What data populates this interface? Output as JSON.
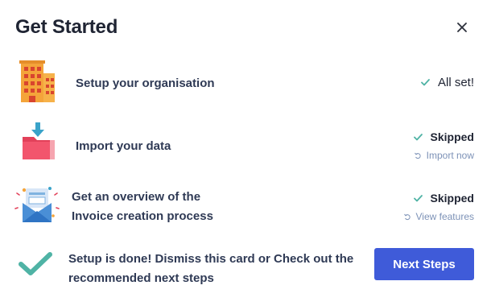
{
  "header": {
    "title": "Get Started",
    "close_icon": "close-icon"
  },
  "steps": [
    {
      "label": "Setup your organisation",
      "status": "All set!",
      "icon": "building-icon"
    },
    {
      "label": "Import your data",
      "status": "Skipped",
      "action": "Import now",
      "icon": "folder-import-icon"
    },
    {
      "label_line1": "Get an overview of the",
      "label_line2": "Invoice creation process",
      "status": "Skipped",
      "action": "View features",
      "icon": "invoice-envelope-icon"
    }
  ],
  "footer": {
    "message_line1": "Setup is done! Dismiss this card or Check out the",
    "message_line2": "recommended next steps",
    "button_label": "Next Steps",
    "icon": "large-check-icon"
  },
  "colors": {
    "accent": "#3f5bd9",
    "check": "#4fb3a5",
    "link": "#7d92b7"
  }
}
